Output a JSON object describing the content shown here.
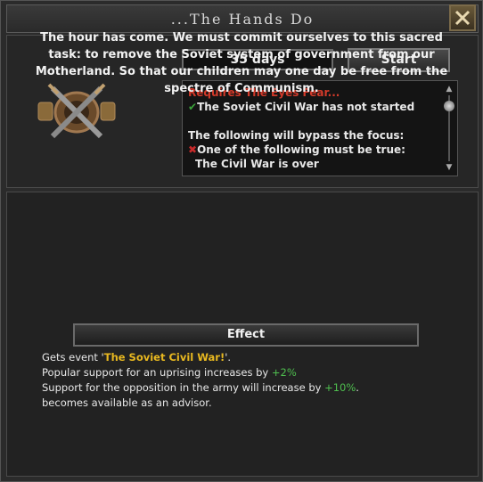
{
  "window": {
    "title": "...The Hands Do"
  },
  "header": {
    "days": "35 days",
    "start_label": "Start"
  },
  "requirements": {
    "lines": [
      {
        "text": "Requires The Eyes Fear...",
        "style": "red"
      },
      {
        "icon": "✔",
        "text": "The Soviet Civil War has not started",
        "style": "check"
      },
      {
        "text": "",
        "style": "blank"
      },
      {
        "text": "The following will bypass the focus:",
        "style": "normal"
      },
      {
        "icon": "✖",
        "text": "One of the following must be true:",
        "style": "cross"
      },
      {
        "text": "The Civil War is over",
        "style": "indent"
      }
    ]
  },
  "description": "The hour has come. We must commit ourselves to this sacred task: to remove the Soviet system of government from our Motherland. So that our children may one day be free from the spectre of Communism.",
  "effect": {
    "header": "Effect",
    "line1_prefix": "Gets event '",
    "line1_event": "The Soviet Civil War!",
    "line1_suffix": "'.",
    "line2_prefix": "Popular support for an uprising increases by ",
    "line2_value": "+2%",
    "line3_prefix": "Support for the opposition in the army will increase by ",
    "line3_value": "+10%",
    "line3_suffix": ".",
    "line4": " becomes available as an advisor."
  },
  "icons": {
    "close": "close-icon",
    "emblem": "crossed-swords-emblem-icon"
  },
  "colors": {
    "requirement_red": "#d23a2a",
    "event_gold": "#e8b820",
    "value_green": "#4fbf4f"
  }
}
